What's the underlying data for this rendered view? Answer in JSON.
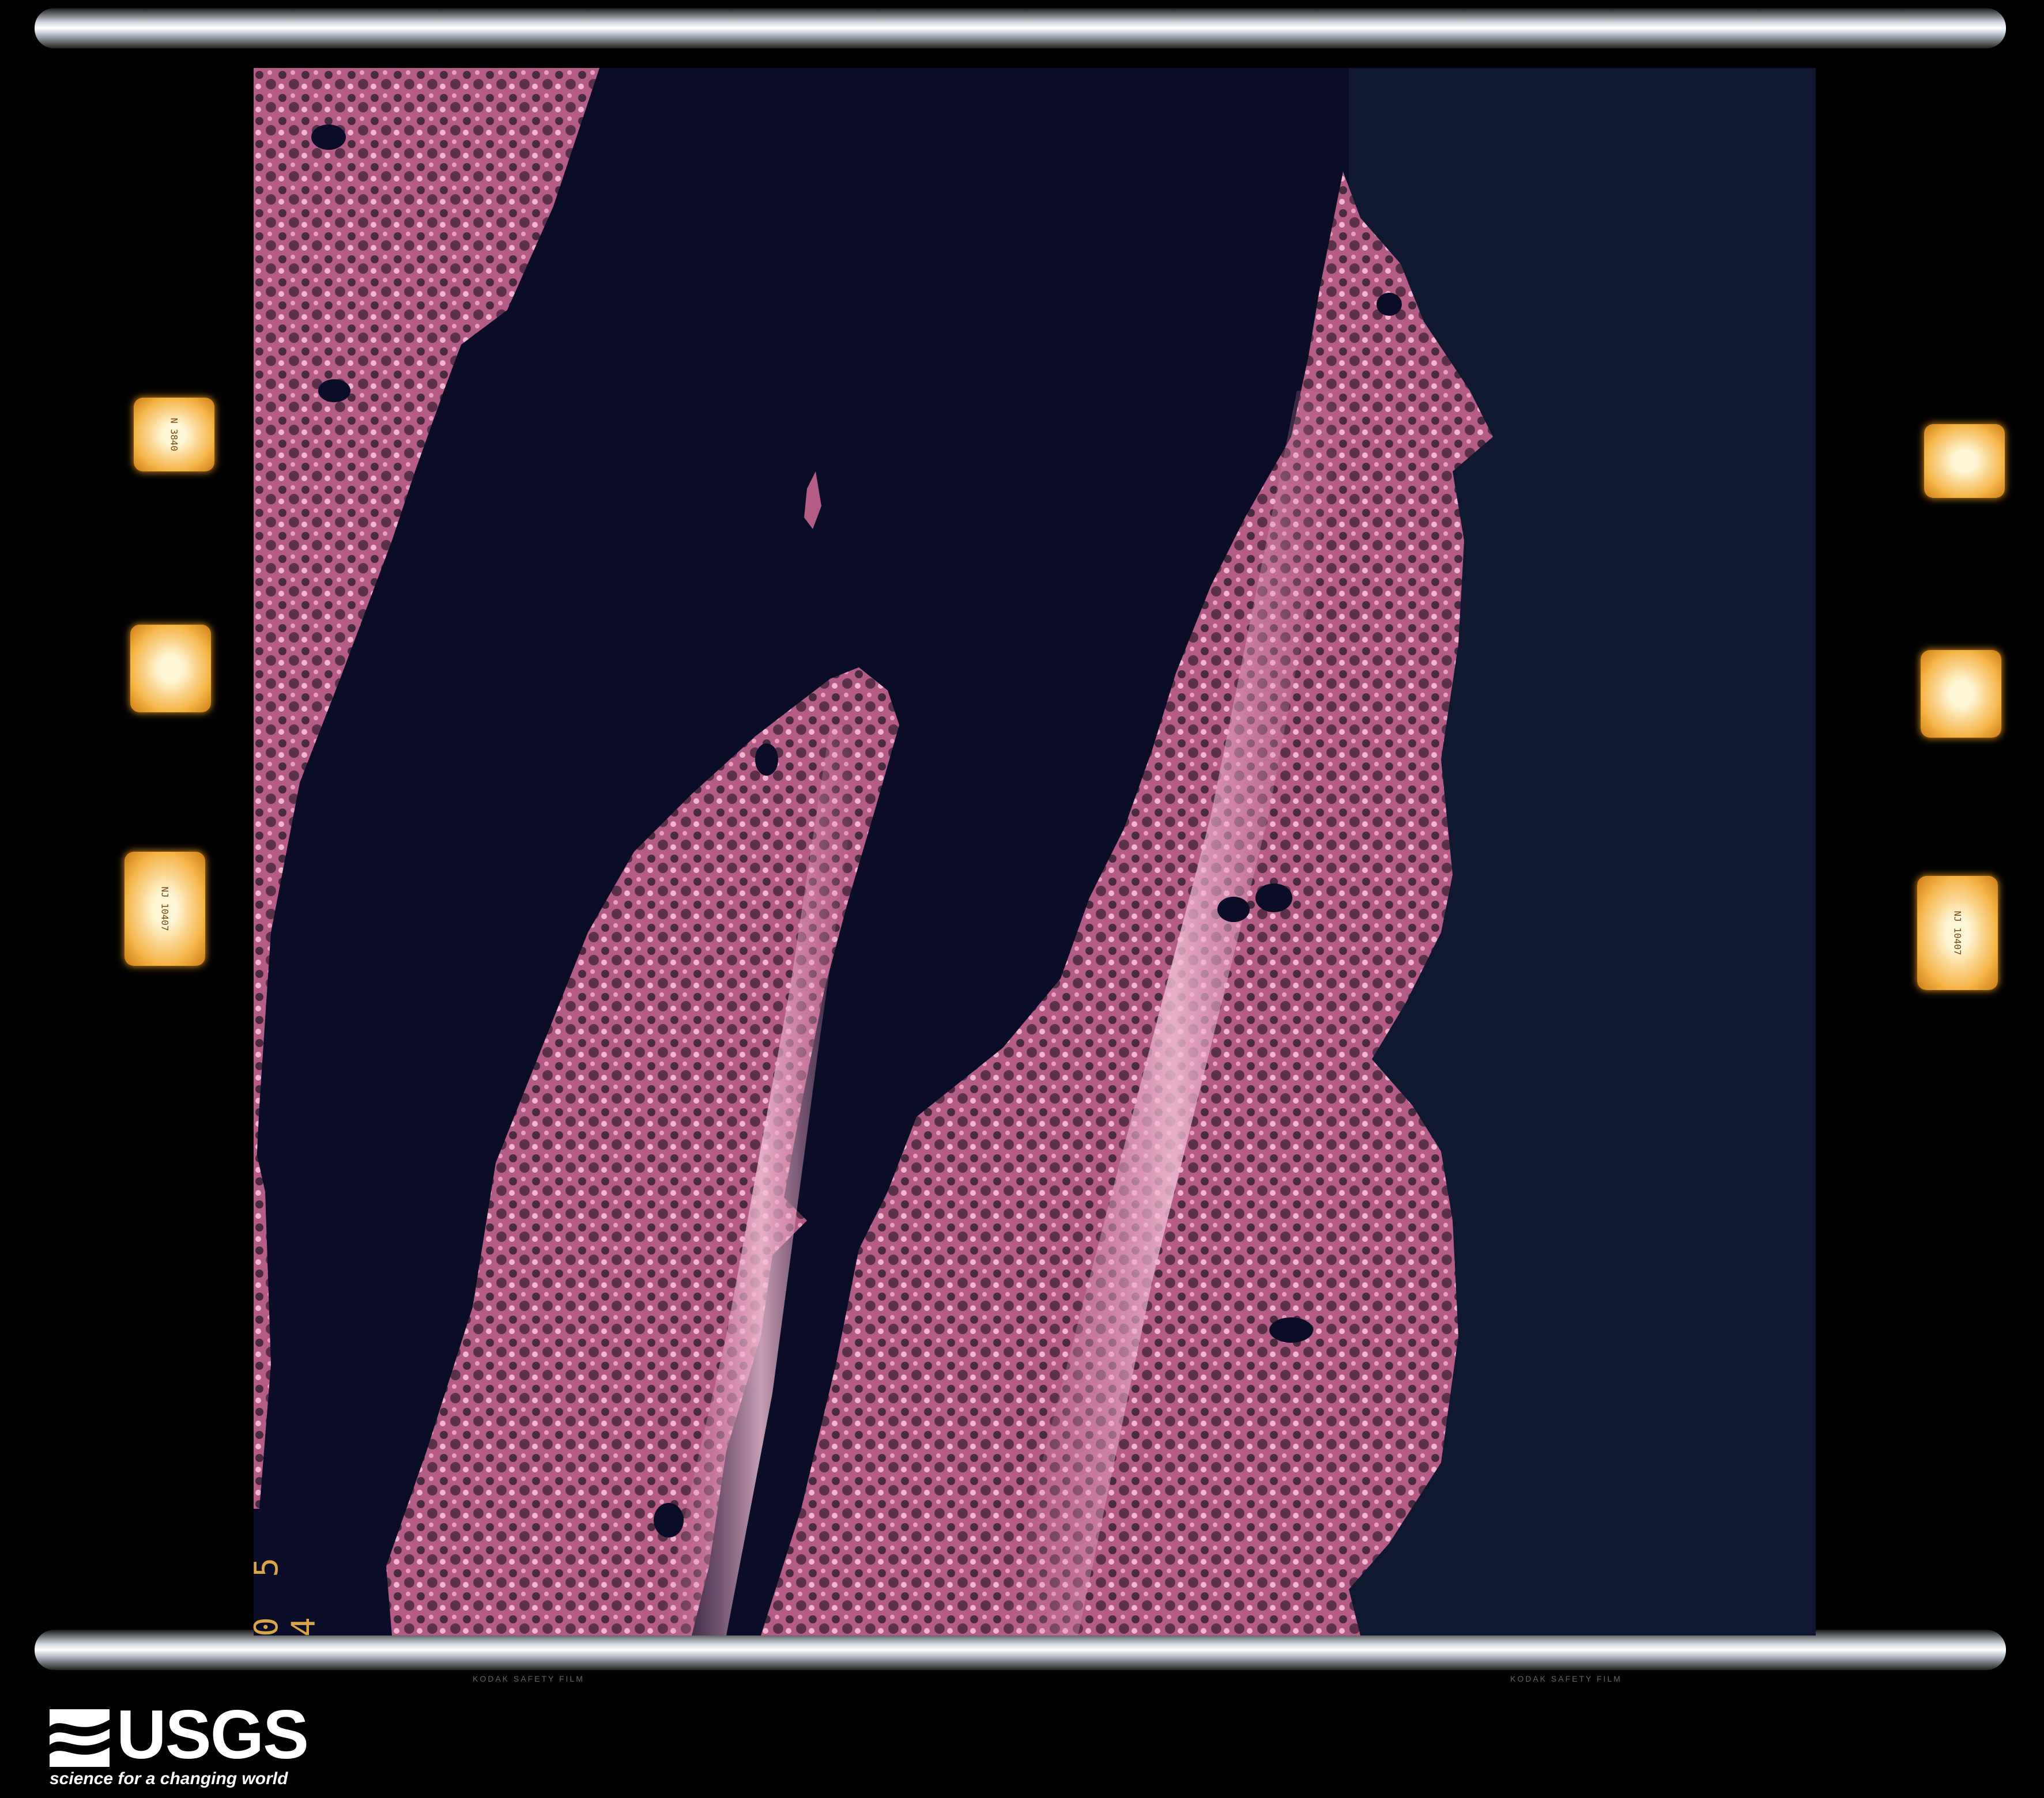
{
  "image": {
    "description_type": "aerial color-infrared film frame",
    "frame_number": "0 5 4",
    "film_edge_text": [
      "KODAK SAFETY FILM",
      "KODAK SAFETY FILM"
    ],
    "fiducial_markers": [
      {
        "side": "left",
        "text": "N 3840"
      },
      {
        "side": "left",
        "text": "clock"
      },
      {
        "side": "left",
        "text": "NJ 10407"
      },
      {
        "side": "right",
        "text": ""
      },
      {
        "side": "right",
        "text": "clock"
      },
      {
        "side": "right",
        "text": "NJ 10407"
      }
    ]
  },
  "branding": {
    "wordmark": "USGS",
    "tagline": "science for a changing world"
  },
  "colors": {
    "land": "#c76a93",
    "land_highlight": "#f0a6c4",
    "land_shadow": "#3b2334",
    "water": "#0b0d28",
    "background": "#000000",
    "marker": "#f4b344"
  }
}
